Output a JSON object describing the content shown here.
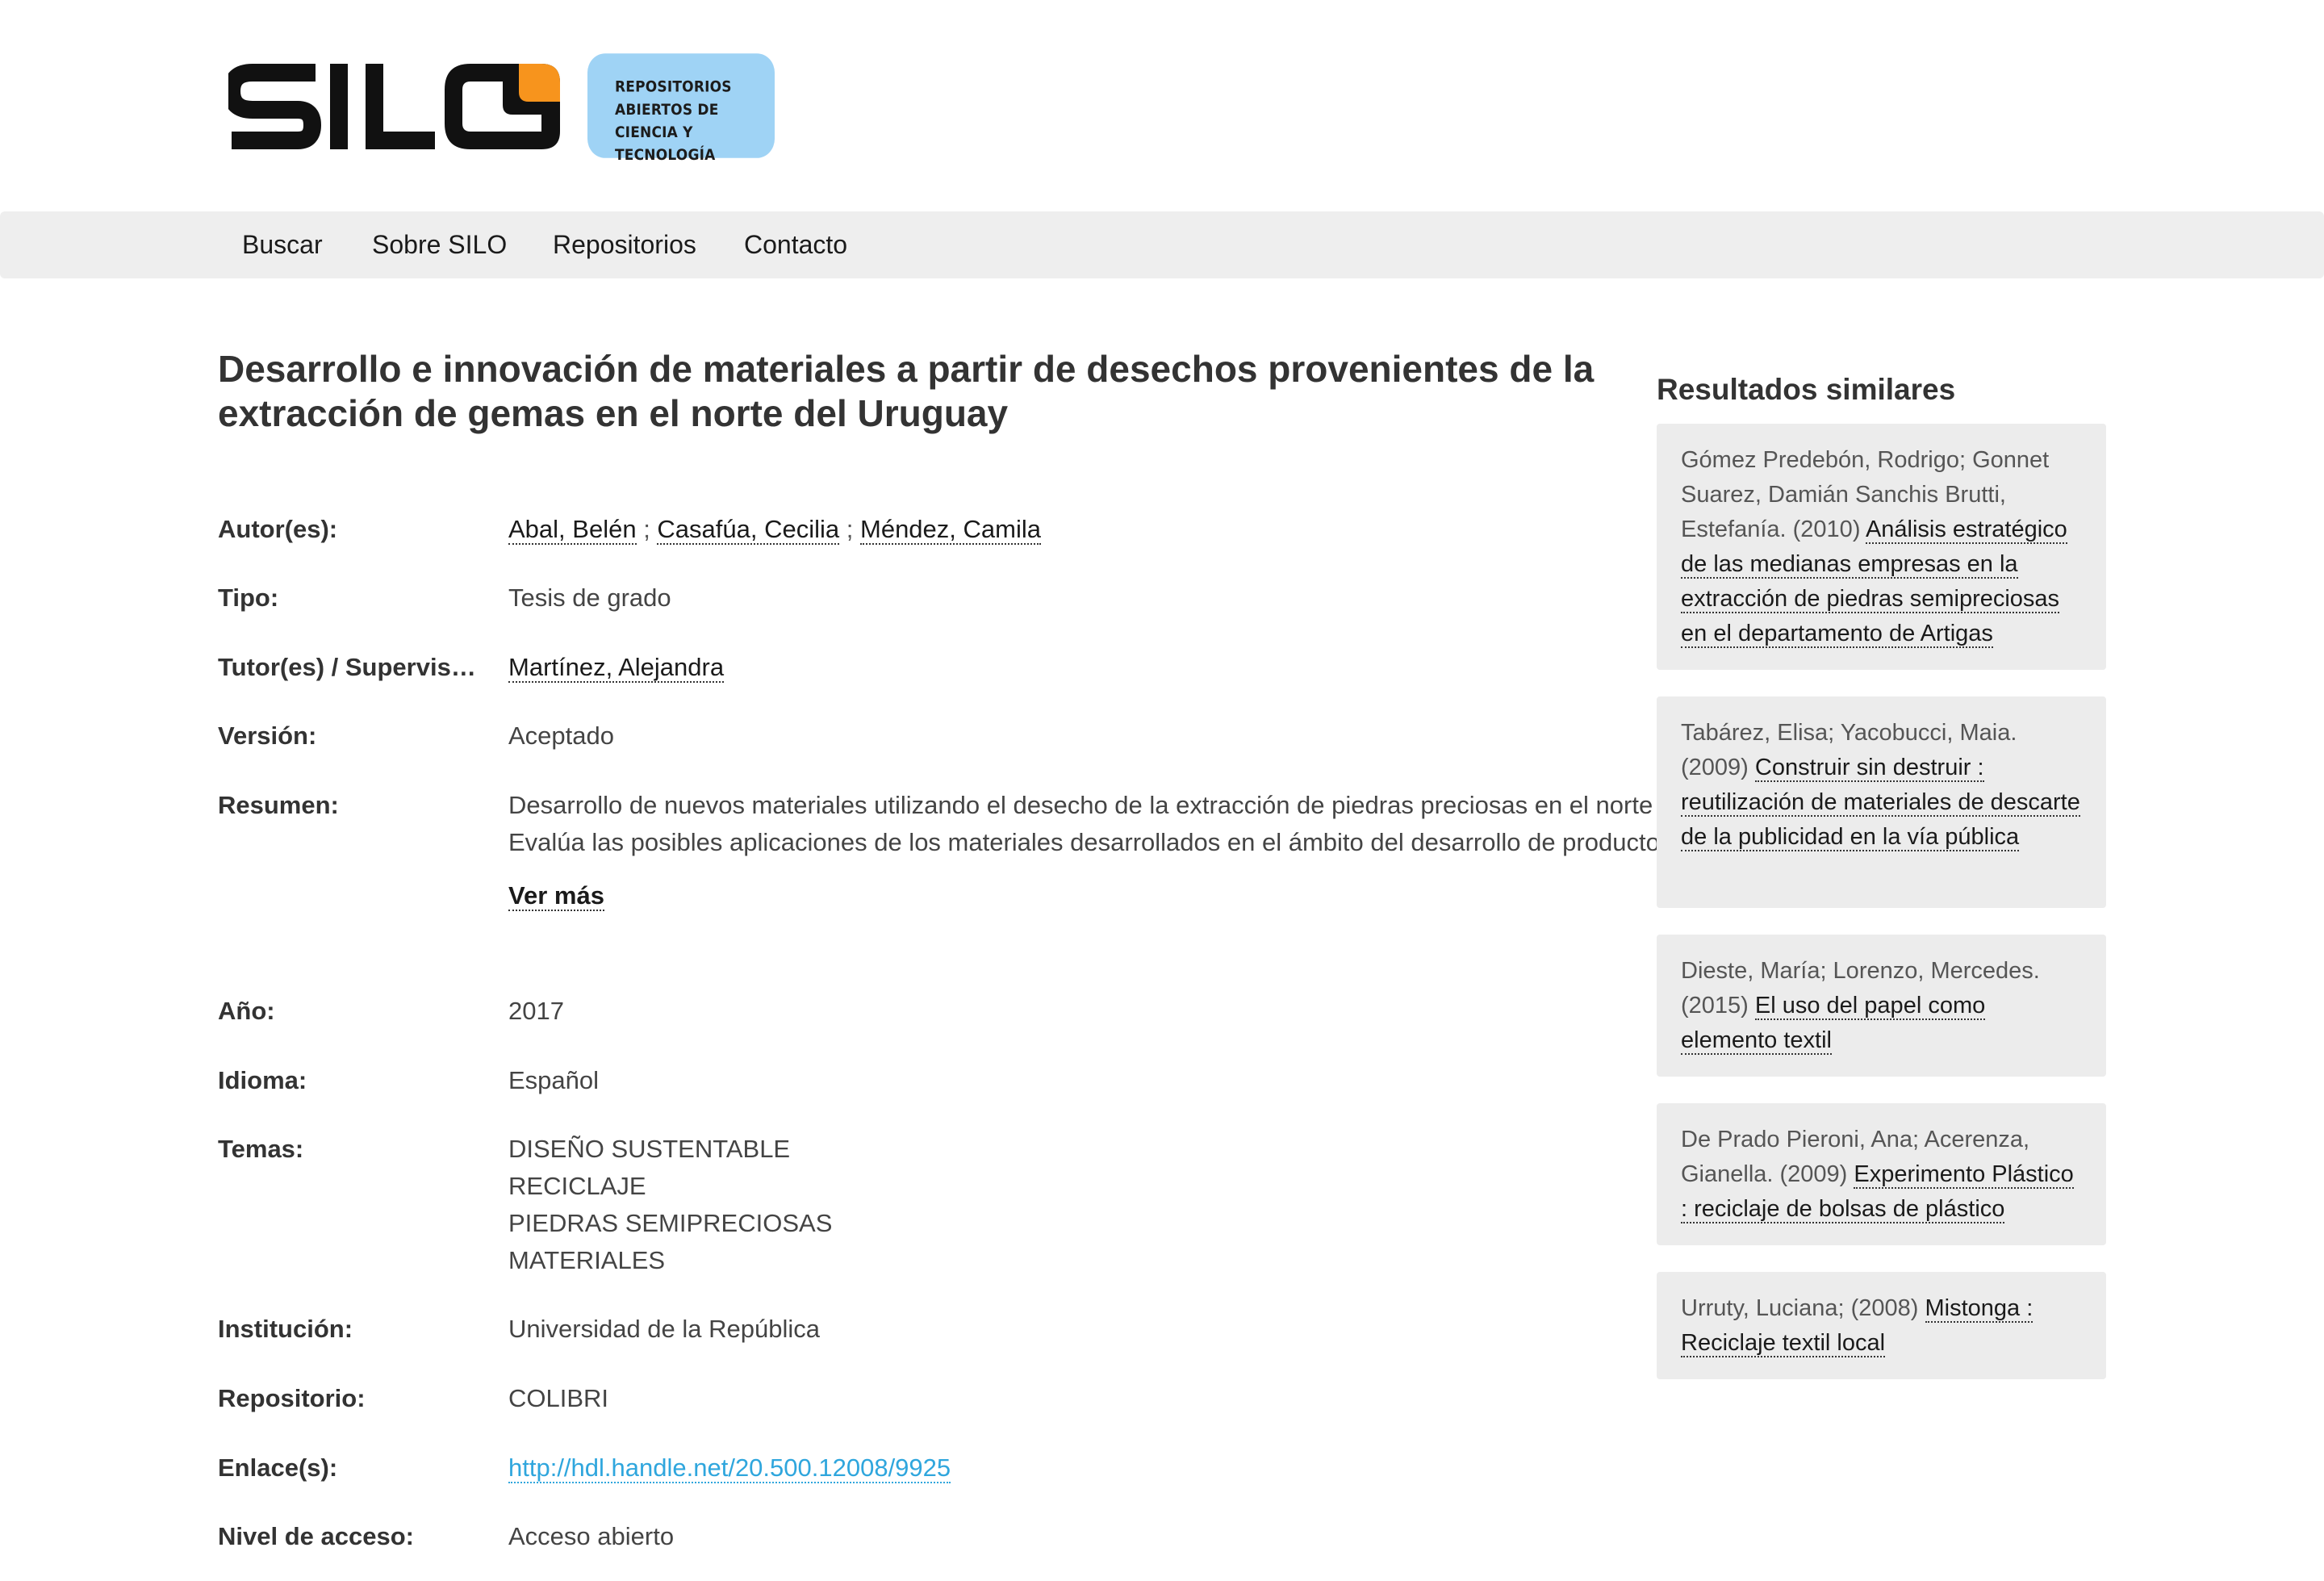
{
  "header": {
    "logo_text": "SILO",
    "tagline_lines": [
      "REPOSITORIOS",
      "ABIERTOS DE CIENCIA Y",
      "TECNOLOGÍA"
    ]
  },
  "nav": {
    "items": [
      "Buscar",
      "Sobre SILO",
      "Repositorios",
      "Contacto"
    ]
  },
  "record": {
    "title": "Desarrollo e innovación de materiales a partir de desechos provenientes de la extracción de gemas en el norte del Uruguay",
    "labels": {
      "authors": "Autor(es):",
      "type": "Tipo:",
      "tutors": "Tutor(es) / Supervisor(es):",
      "version": "Versión:",
      "abstract": "Resumen:",
      "year": "Año:",
      "language": "Idioma:",
      "topics": "Temas:",
      "institution": "Institución:",
      "repository": "Repositorio:",
      "links": "Enlace(s):",
      "access": "Nivel de acceso:"
    },
    "authors": [
      "Abal, Belén",
      "Casafúa, Cecilia",
      "Méndez, Camila"
    ],
    "author_separator": ";",
    "type": "Tesis de grado",
    "tutor": "Martínez, Alejandra",
    "version": "Aceptado",
    "abstract": "Desarrollo de nuevos materiales utilizando el desecho de la extracción de piedras preciosas en el norte del país. Evalúa las posibles aplicaciones de los materiales desarrollados en el ámbito del desarrollo de productos.",
    "ver_mas": "Ver más",
    "year": "2017",
    "language": "Español",
    "topics": [
      "DISEÑO SUSTENTABLE",
      "RECICLAJE",
      "PIEDRAS SEMIPRECIOSAS",
      "MATERIALES"
    ],
    "institution": "Universidad de la República",
    "repository": "COLIBRI",
    "link": "http://hdl.handle.net/20.500.12008/9925",
    "access": "Acceso abierto"
  },
  "sidebar": {
    "title": "Resultados similares",
    "results": [
      {
        "prefix": "Gómez Predebón, Rodrigo; Gonnet Suarez, Damián Sanchis Brutti, Estefanía. (2010) ",
        "link": "Análisis estratégico de las medianas empresas en la extracción de piedras semipreciosas en el departamento de Artigas"
      },
      {
        "prefix": "Tabárez, Elisa; Yacobucci, Maia. (2009) ",
        "link": "Construir sin destruir : reutilización de materiales de descarte de la publicidad en la vía pública"
      },
      {
        "prefix": "Dieste, María; Lorenzo, Mercedes. (2015) ",
        "link": "El uso del papel como elemento textil"
      },
      {
        "prefix": "De Prado Pieroni, Ana; Acerenza, Gianella. (2009) ",
        "link": "Experimento Plástico : reciclaje de bolsas de plástico"
      },
      {
        "prefix": "Urruty, Luciana; (2008) ",
        "link": "Mistonga : Reciclaje textil local"
      }
    ]
  },
  "colors": {
    "logo_orange": "#f7941d",
    "logo_black": "#111111",
    "tag_blue": "#9fd3f5",
    "nav_bg": "#eeeeee",
    "link_blue": "#2fa6dd",
    "card_bg": "#ececec"
  }
}
